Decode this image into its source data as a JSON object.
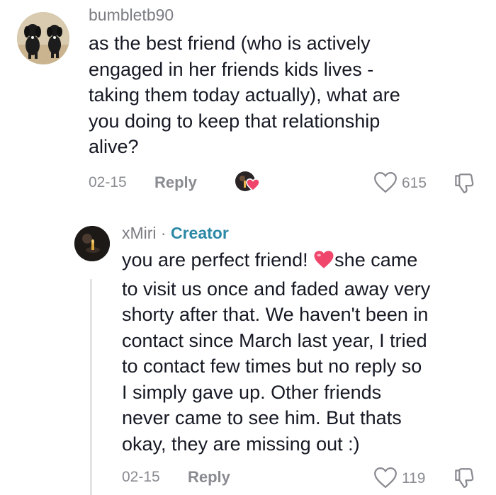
{
  "comments": [
    {
      "username": "bumbletb90",
      "text": "as the best friend (who is actively engaged in her friends kids lives - taking them today actually), what are you doing to keep that relationship alive?",
      "lines": [
        "as the best friend (who is actively",
        "engaged in her friends kids lives -",
        "taking them today actually), what are",
        "you doing to keep that relationship",
        "alive?"
      ],
      "date": "02-15",
      "reply_label": "Reply",
      "like_count": "615"
    }
  ],
  "reply": {
    "username": "xMiri",
    "separator": " · ",
    "badge": "Creator",
    "lines": [
      "you are perfect friend!",
      "she came",
      "to visit us once and faded away very",
      "shorty after that. We haven't been in",
      "contact since March last year, I tried",
      "to contact few times but no reply so",
      "I simply gave up. Other friends",
      "never came to see him. But thats",
      "okay, they are missing out :)"
    ],
    "date": "02-15",
    "reply_label": "Reply",
    "like_count": "119"
  },
  "colors": {
    "heart_emoji": "#f0466b",
    "creator_badge": "#2b88a6",
    "meta": "#8a8b91"
  },
  "icons": [
    "like-heart-outline-icon",
    "dislike-icon",
    "creator-liked-heart-icon"
  ]
}
